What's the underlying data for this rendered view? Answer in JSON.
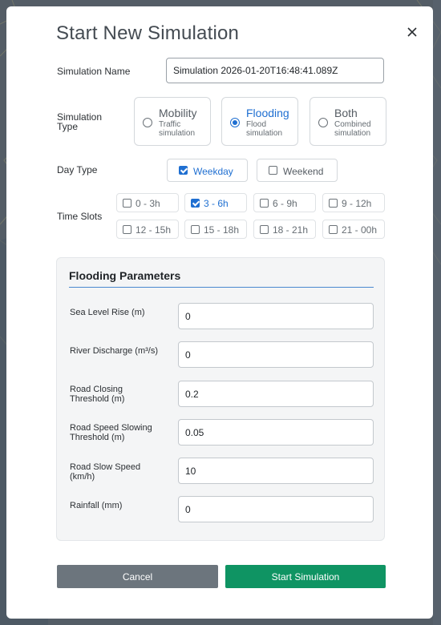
{
  "dialog": {
    "title": "Start New Simulation",
    "close_icon": "close-icon"
  },
  "form": {
    "simulation_name": {
      "label": "Simulation Name",
      "value": "Simulation 2026-01-20T16:48:41.089Z"
    },
    "simulation_type": {
      "label_line1": "Simulation",
      "label_line2": "Type",
      "selected": "Flooding",
      "options": [
        {
          "title": "Mobility",
          "line1": "Traffic",
          "line2": "simulation"
        },
        {
          "title": "Flooding",
          "line1": "Flood",
          "line2": "simulation"
        },
        {
          "title": "Both",
          "line1": "Combined",
          "line2": "simulation"
        }
      ]
    },
    "day_type": {
      "label": "Day Type",
      "options": [
        {
          "label": "Weekday",
          "checked": true
        },
        {
          "label": "Weekend",
          "checked": false
        }
      ]
    },
    "time_slots": {
      "label": "Time Slots",
      "slots": [
        {
          "label": "0 - 3h",
          "checked": false
        },
        {
          "label": "3 - 6h",
          "checked": true
        },
        {
          "label": "6 - 9h",
          "checked": false
        },
        {
          "label": "9 - 12h",
          "checked": false
        },
        {
          "label": "12 - 15h",
          "checked": false
        },
        {
          "label": "15 - 18h",
          "checked": false
        },
        {
          "label": "18 - 21h",
          "checked": false
        },
        {
          "label": "21 - 00h",
          "checked": false
        }
      ]
    }
  },
  "flooding_parameters": {
    "title": "Flooding Parameters",
    "fields": [
      {
        "line1": "Sea Level Rise (m)",
        "line2": "",
        "value": "0"
      },
      {
        "line1": "River Discharge (m³/s)",
        "line2": "",
        "value": "0"
      },
      {
        "line1": "Road Closing",
        "line2": "Threshold (m)",
        "value": "0.2"
      },
      {
        "line1": "Road Speed Slowing",
        "line2": "Threshold (m)",
        "value": "0.05"
      },
      {
        "line1": "Road Slow Speed",
        "line2": "(km/h)",
        "value": "10"
      },
      {
        "line1": "Rainfall (mm)",
        "line2": "",
        "value": "0"
      }
    ]
  },
  "actions": {
    "cancel_label": "Cancel",
    "start_label": "Start Simulation",
    "cancel_color": "#6c757d",
    "start_color": "#0f9463"
  },
  "colors": {
    "accent": "#1f6fd1",
    "backdrop": "#4e5660"
  }
}
